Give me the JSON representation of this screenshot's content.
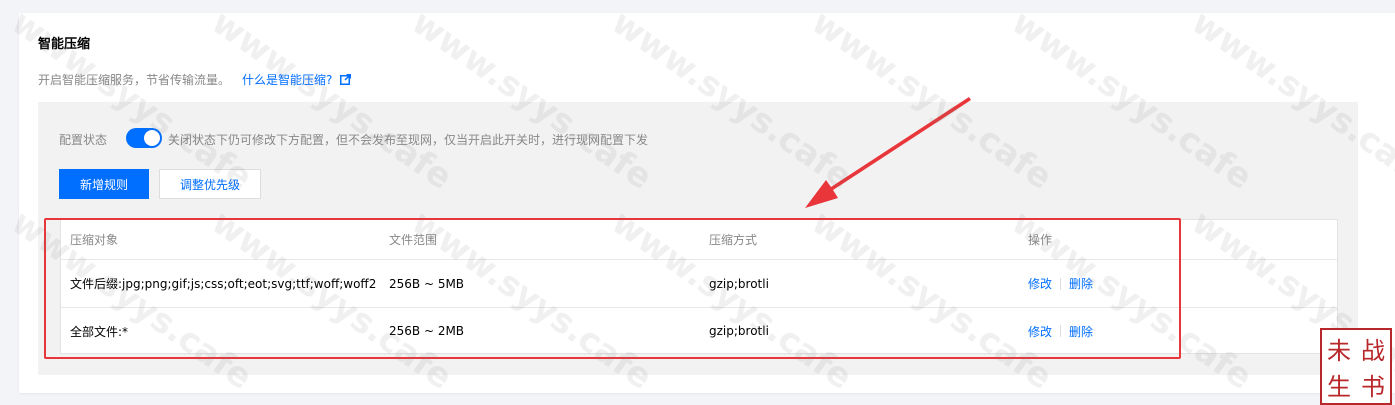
{
  "section": {
    "title": "智能压缩",
    "description": "开启智能压缩服务，节省传输流量。",
    "help_link": "什么是智能压缩?"
  },
  "config": {
    "status_label": "配置状态",
    "toggle_on": true,
    "status_tip": "关闭状态下仍可修改下方配置，但不会发布至现网，仅当开启此开关时，进行现网配置下发"
  },
  "buttons": {
    "add_rule": "新增规则",
    "adjust_priority": "调整优先级"
  },
  "table": {
    "columns": [
      "压缩对象",
      "文件范围",
      "压缩方式",
      "操作"
    ],
    "rows": [
      {
        "target": "文件后缀:jpg;png;gif;js;css;oft;eot;svg;ttf;woff;woff2",
        "range": "256B ~ 5MB",
        "method": "gzip;brotli",
        "edit": "修改",
        "delete": "删除"
      },
      {
        "target": "全部文件:*",
        "range": "256B ~ 2MB",
        "method": "gzip;brotli",
        "edit": "修改",
        "delete": "删除"
      }
    ]
  },
  "watermark": "www.syys.cafe",
  "seal": [
    "战",
    "书",
    "生",
    "未"
  ],
  "colors": {
    "accent": "#006eff",
    "annotation_red": "#e8363b",
    "seal_red": "#b8272a"
  }
}
